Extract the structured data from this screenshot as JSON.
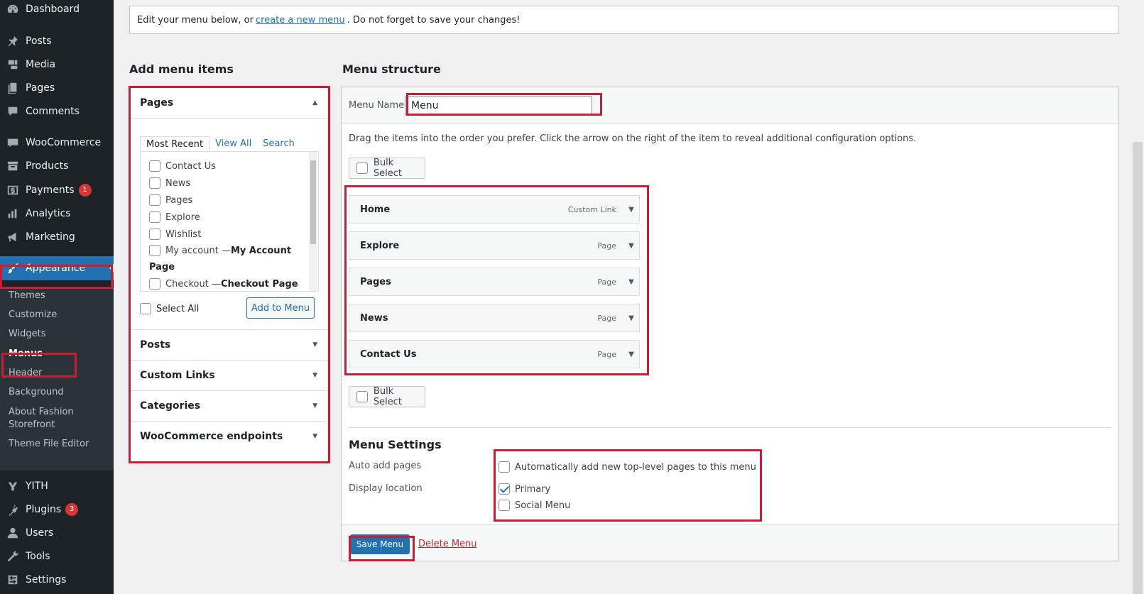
{
  "sidebar": {
    "items": [
      {
        "label": "Dashboard",
        "icon": "dashboard-icon"
      },
      {
        "label": "Posts",
        "icon": "pin-icon"
      },
      {
        "label": "Media",
        "icon": "media-icon"
      },
      {
        "label": "Pages",
        "icon": "pages-icon"
      },
      {
        "label": "Comments",
        "icon": "comment-icon"
      },
      {
        "label": "WooCommerce",
        "icon": "woo-icon"
      },
      {
        "label": "Products",
        "icon": "archive-icon"
      },
      {
        "label": "Payments",
        "icon": "dollar-icon",
        "badge": "1"
      },
      {
        "label": "Analytics",
        "icon": "bar-chart-icon"
      },
      {
        "label": "Marketing",
        "icon": "megaphone-icon"
      },
      {
        "label": "Appearance",
        "icon": "paintbrush-icon"
      },
      {
        "label": "YITH",
        "icon": "yith-icon"
      },
      {
        "label": "Plugins",
        "icon": "plug-icon",
        "badge": "3"
      },
      {
        "label": "Users",
        "icon": "user-icon"
      },
      {
        "label": "Tools",
        "icon": "wrench-icon"
      },
      {
        "label": "Settings",
        "icon": "sliders-icon"
      }
    ],
    "submenu": [
      "Themes",
      "Customize",
      "Widgets",
      "Menus",
      "Header",
      "Background",
      "About Fashion Storefront",
      "Theme File Editor"
    ],
    "submenu_line2": "Storefront",
    "submenu_line1": "About Fashion"
  },
  "notice": {
    "before": "Edit your menu below, or",
    "link": "create a new menu",
    "after": ". Do not forget to save your changes!"
  },
  "add_items": {
    "heading": "Add menu items",
    "pages_section": "Pages",
    "tabs": [
      "Most Recent",
      "View All",
      "Search"
    ],
    "pages": [
      {
        "label": "Contact Us",
        "suffix": ""
      },
      {
        "label": "News",
        "suffix": ""
      },
      {
        "label": "Pages",
        "suffix": ""
      },
      {
        "label": "Explore",
        "suffix": ""
      },
      {
        "label": "Wishlist",
        "suffix": ""
      },
      {
        "label": "My account — ",
        "suffix": "My Account"
      },
      {
        "label": "",
        "suffix": "Page"
      },
      {
        "label": "Checkout — ",
        "suffix": "Checkout Page"
      }
    ],
    "select_all": "Select All",
    "add_button": "Add to Menu",
    "sections": [
      "Posts",
      "Custom Links",
      "Categories",
      "WooCommerce endpoints"
    ]
  },
  "structure": {
    "heading": "Menu structure",
    "name_label": "Menu Name",
    "name_value": "Menu",
    "instructions": "Drag the items into the order you prefer. Click the arrow on the right of the item to reveal additional configuration options.",
    "bulk_select": "Bulk Select",
    "items": [
      {
        "title": "Home",
        "type": "Custom Link"
      },
      {
        "title": "Explore",
        "type": "Page"
      },
      {
        "title": "Pages",
        "type": "Page"
      },
      {
        "title": "News",
        "type": "Page"
      },
      {
        "title": "Contact Us",
        "type": "Page"
      }
    ],
    "settings_heading": "Menu Settings",
    "auto_add_label": "Auto add pages",
    "auto_add_option": "Automatically add new top-level pages to this menu",
    "display_location_label": "Display location",
    "locations": [
      {
        "label": "Primary",
        "checked": true
      },
      {
        "label": "Social Menu",
        "checked": false
      }
    ],
    "save_button": "Save Menu",
    "delete_link": "Delete Menu"
  },
  "colors": {
    "sidebar_bg": "#1d2327",
    "accent": "#2271b1",
    "highlight": "#c81d33",
    "badge": "#d63638"
  }
}
